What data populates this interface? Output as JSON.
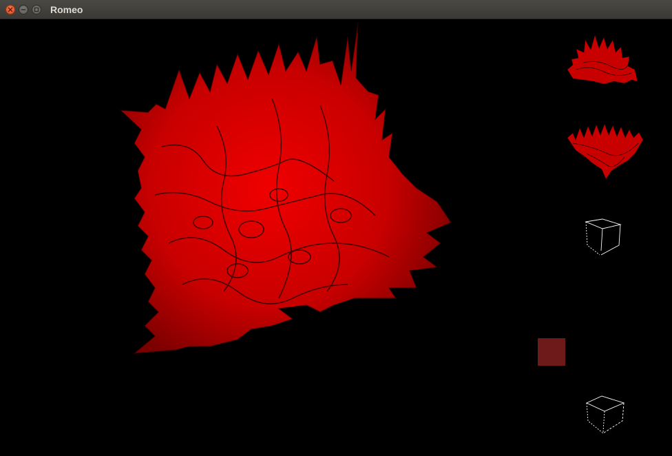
{
  "window": {
    "title": "Romeo"
  },
  "titlebar_icons": {
    "close": "close-icon",
    "minimize": "minimize-icon",
    "maximize": "maximize-icon"
  },
  "scene": {
    "background_color": "#000000",
    "object_color": "#e00000",
    "object_shadow_color": "#3a0000",
    "wireframe_color": "#ffffff",
    "swatch_color": "#6e1a1a"
  }
}
